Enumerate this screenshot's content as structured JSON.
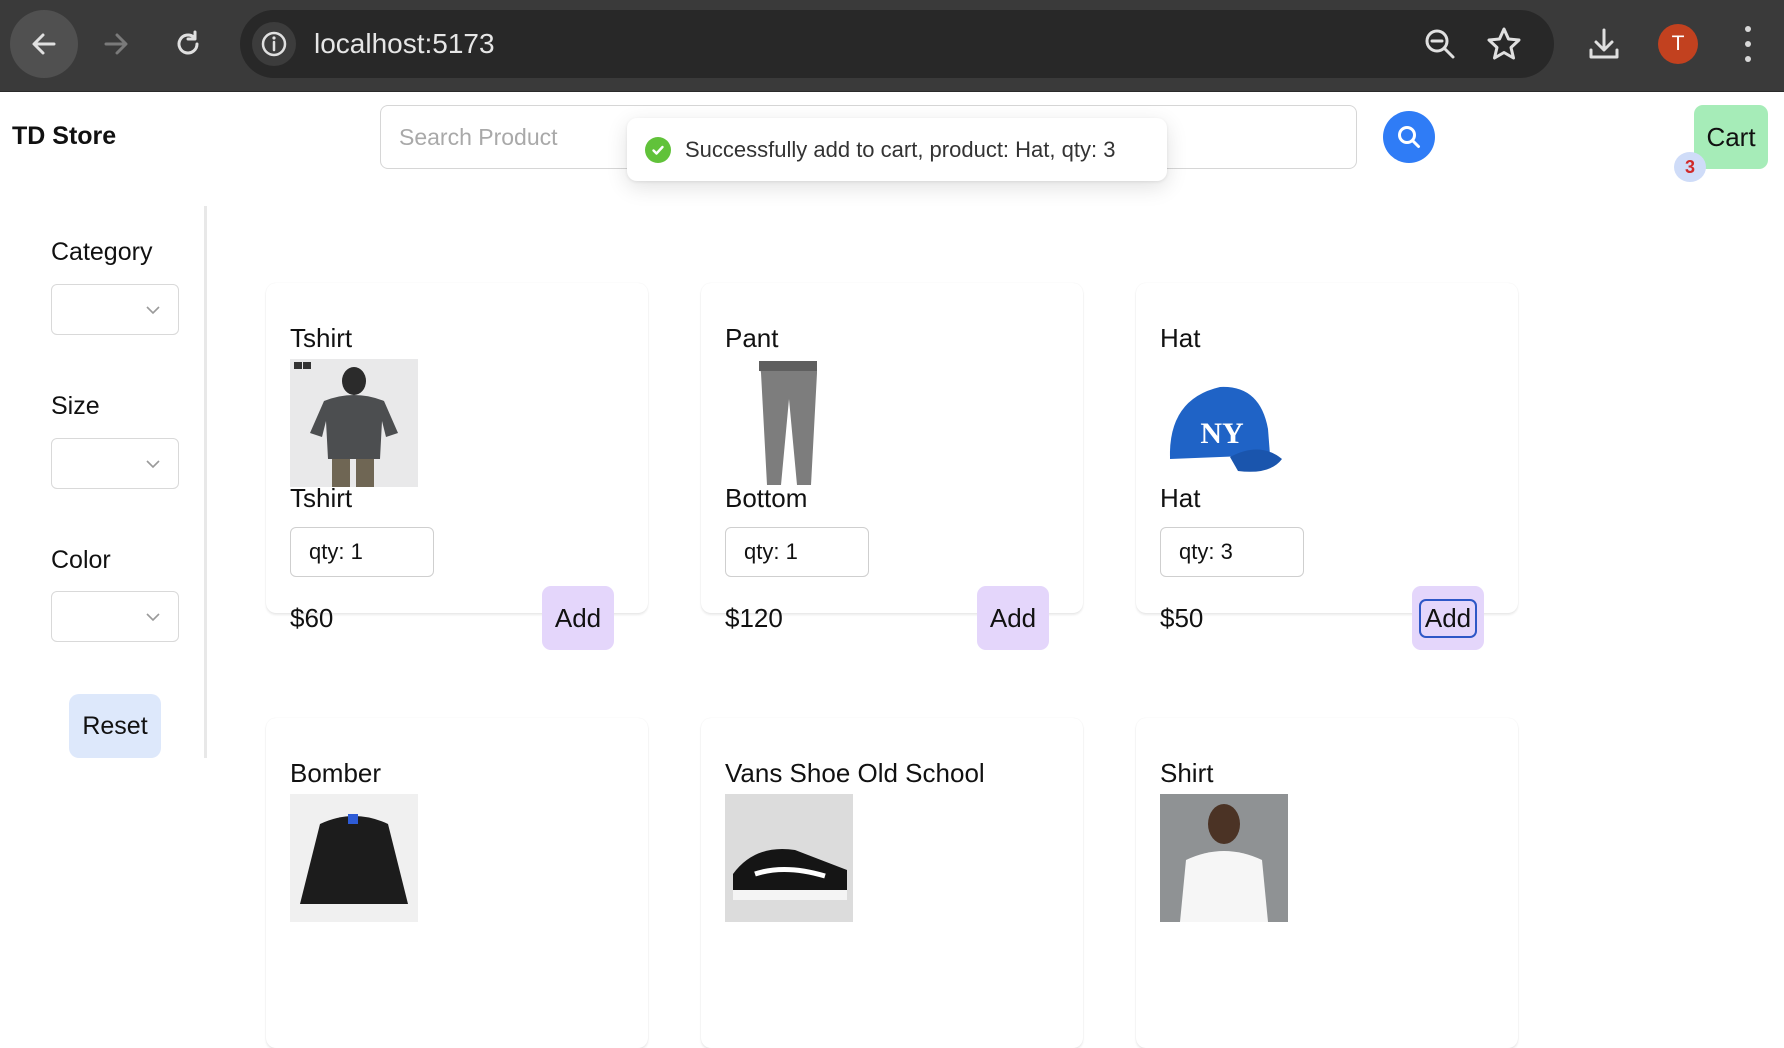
{
  "browser": {
    "url": "localhost:5173",
    "profile_initial": "T",
    "icons": [
      "back-arrow-icon",
      "forward-arrow-icon",
      "reload-icon",
      "site-info-icon",
      "zoom-out-icon",
      "bookmark-star-icon",
      "download-icon",
      "more-menu-icon"
    ]
  },
  "header": {
    "brand": "TD Store",
    "search_placeholder": "Search Product",
    "cart_label": "Cart",
    "cart_count": "3"
  },
  "toast": {
    "message": "Successfully add to cart, product: Hat, qty: 3"
  },
  "sidebar": {
    "filters": [
      {
        "label": "Category",
        "value": ""
      },
      {
        "label": "Size",
        "value": ""
      },
      {
        "label": "Color",
        "value": ""
      }
    ],
    "reset_label": "Reset"
  },
  "products": [
    {
      "name": "Tshirt",
      "category": "Tshirt",
      "qty": "qty: 1",
      "price": "$60",
      "add_label": "Add"
    },
    {
      "name": "Pant",
      "category": "Bottom",
      "qty": "qty: 1",
      "price": "$120",
      "add_label": "Add"
    },
    {
      "name": "Hat",
      "category": "Hat",
      "qty": "qty: 3",
      "price": "$50",
      "add_label": "Add"
    },
    {
      "name": "Bomber"
    },
    {
      "name": "Vans Shoe Old School"
    },
    {
      "name": "Shirt"
    }
  ],
  "colors": {
    "search_button": "#2f7cf6",
    "cart_button": "#a6ecb8",
    "add_button": "#e4d6fb",
    "reset_button": "#dde8fb",
    "toast_check": "#61c23a"
  }
}
